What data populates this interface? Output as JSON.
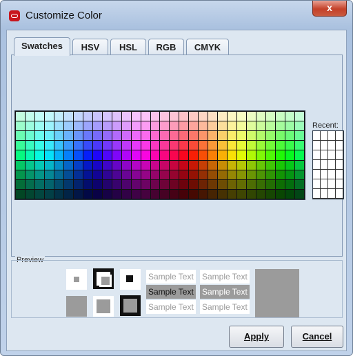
{
  "window": {
    "title": "Customize Color",
    "close_label": "x"
  },
  "tabs": [
    {
      "label": "Swatches",
      "active": true
    },
    {
      "label": "HSV",
      "active": false
    },
    {
      "label": "HSL",
      "active": false
    },
    {
      "label": "RGB",
      "active": false
    },
    {
      "label": "CMYK",
      "active": false
    }
  ],
  "recent": {
    "label": "Recent:"
  },
  "preview": {
    "label": "Preview",
    "sample_text": "Sample Text",
    "swatch_color": "#9b9b9b"
  },
  "buttons": {
    "apply": "Apply",
    "cancel": "Cancel"
  },
  "colors": {
    "accent": "#c8161d",
    "panel": "#dde7f1"
  }
}
